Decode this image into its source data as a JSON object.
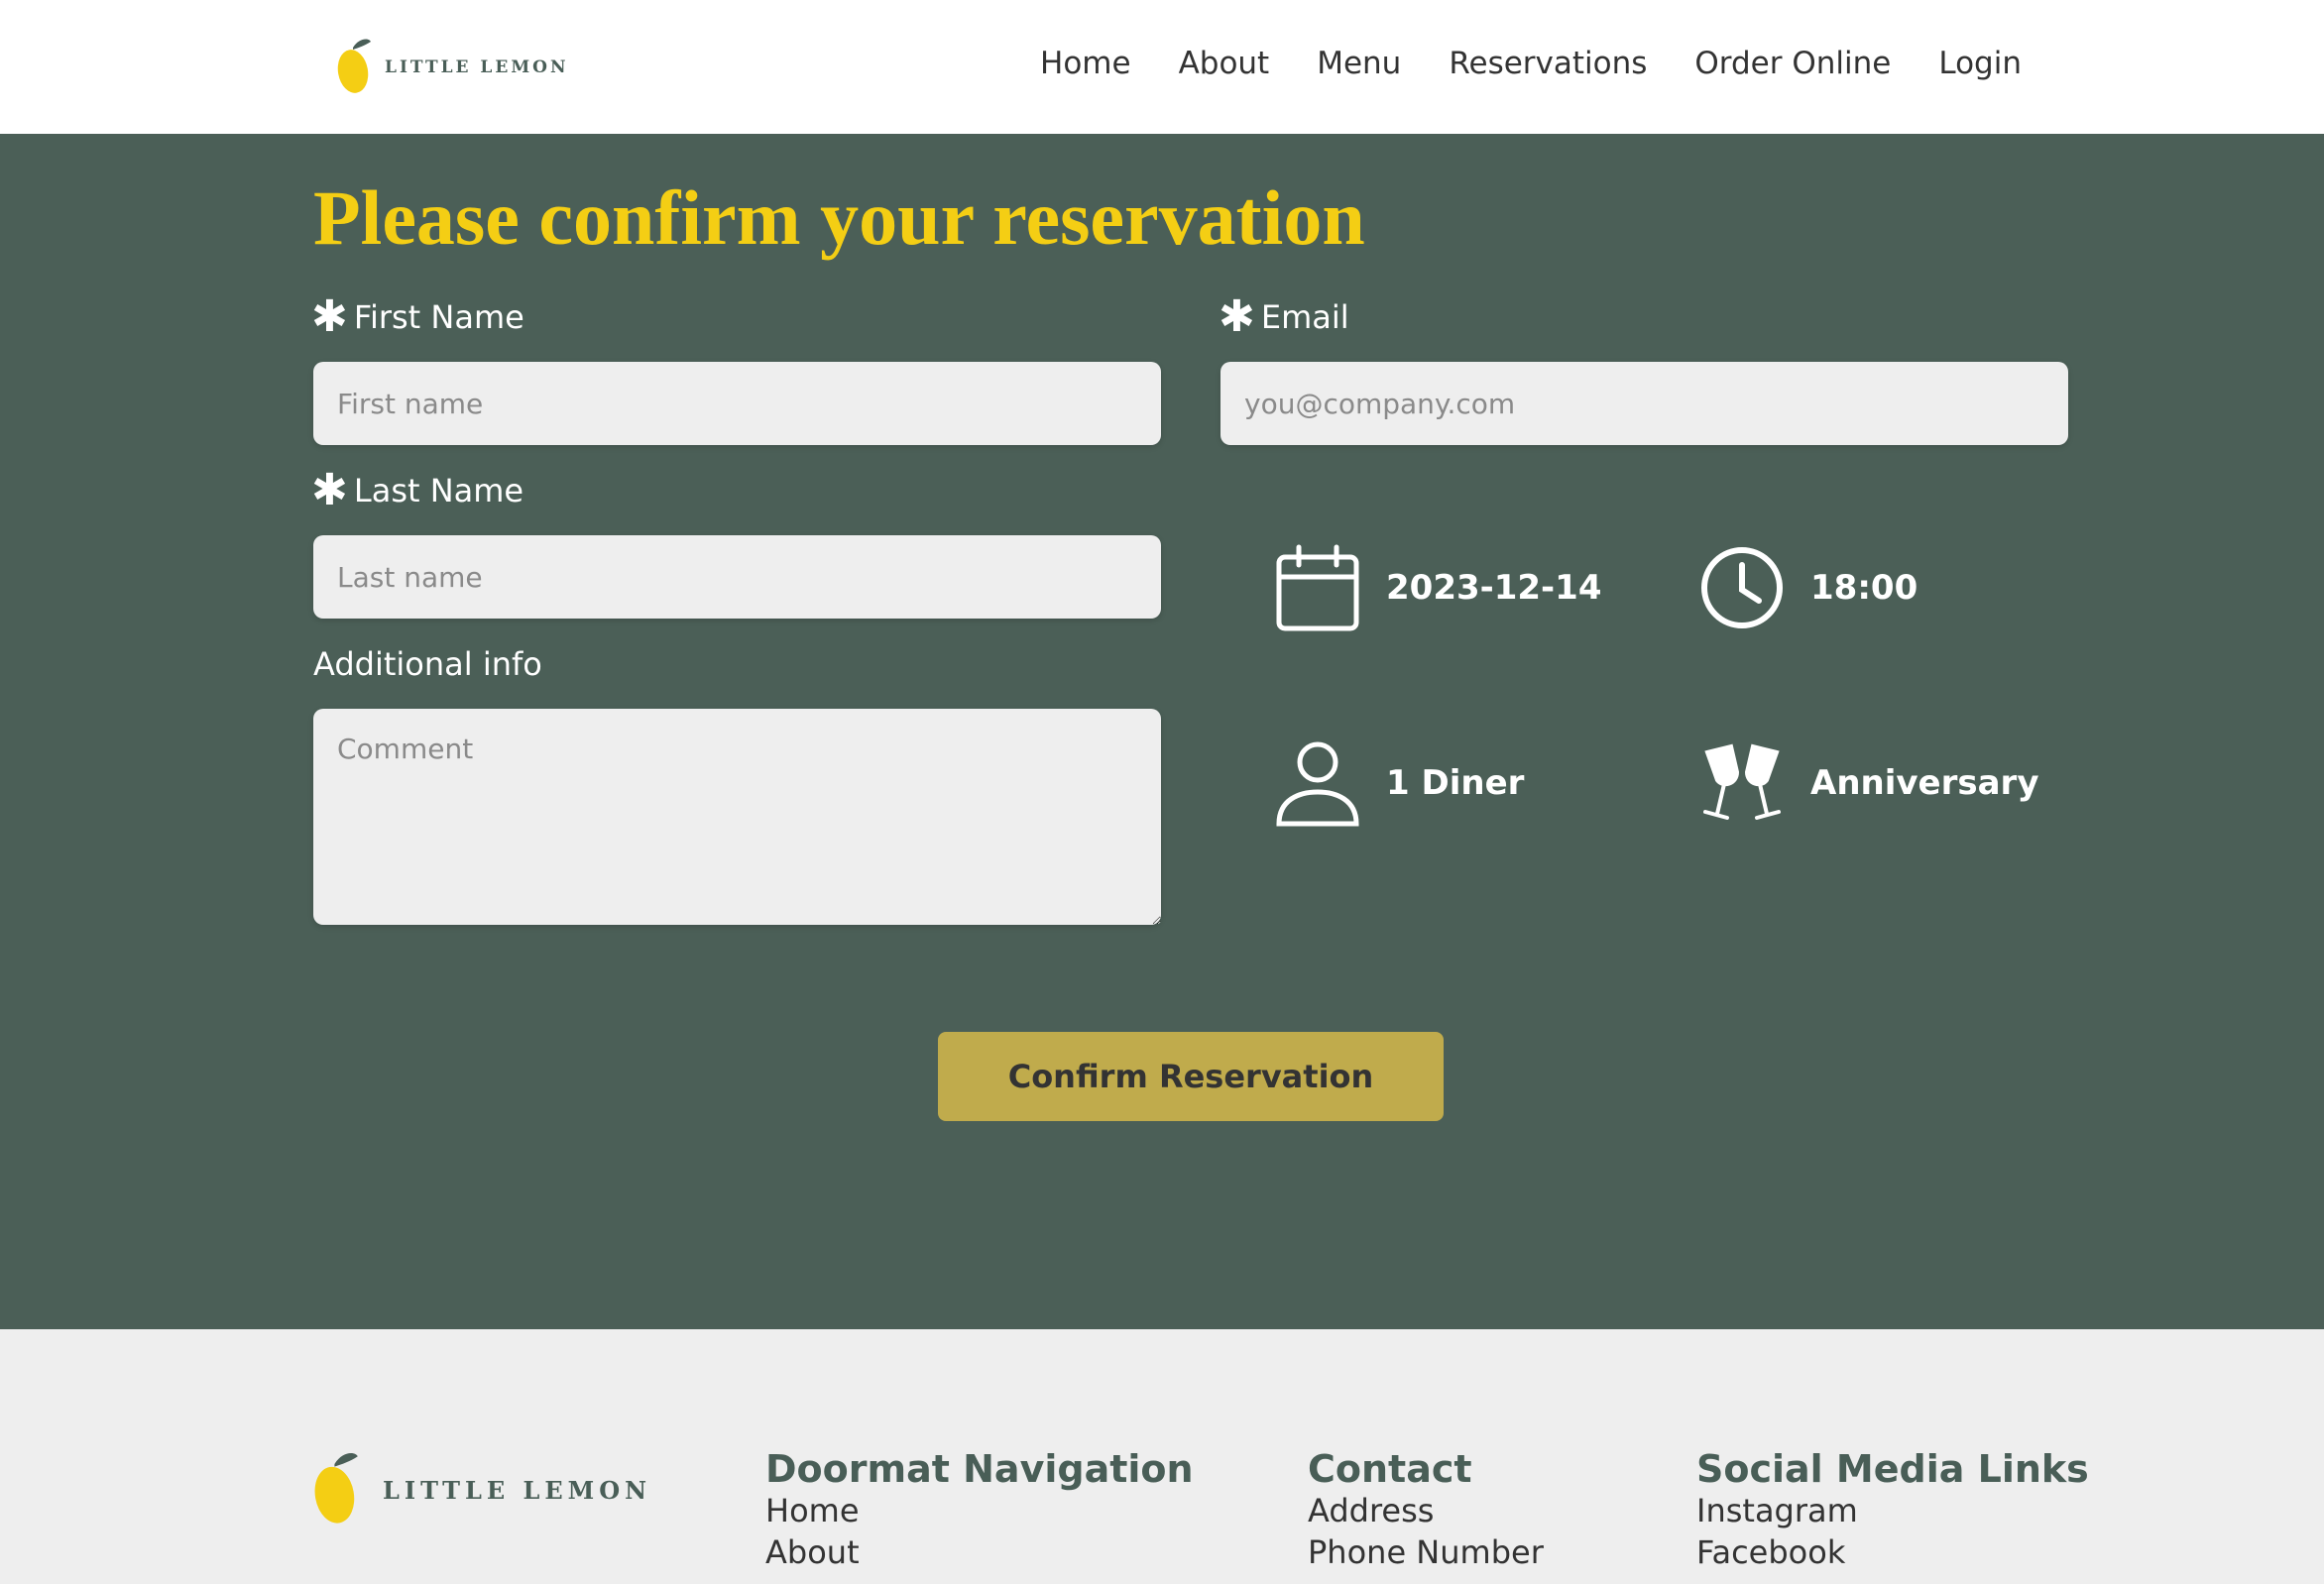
{
  "header": {
    "logo_text": "LITTLE LEMON",
    "nav": [
      "Home",
      "About",
      "Menu",
      "Reservations",
      "Order Online",
      "Login"
    ]
  },
  "main": {
    "title": "Please confirm your reservation",
    "required_marker": "✱",
    "first_name": {
      "label": "First Name",
      "placeholder": "First name"
    },
    "last_name": {
      "label": "Last Name",
      "placeholder": "Last name"
    },
    "additional": {
      "label": "Additional info",
      "placeholder": "Comment"
    },
    "email": {
      "label": "Email",
      "placeholder": "you@company.com"
    },
    "summary": {
      "date": "2023-12-14",
      "time": "18:00",
      "diners": "1 Diner",
      "occasion": "Anniversary"
    },
    "confirm_label": "Confirm Reservation"
  },
  "footer": {
    "logo_text": "LITTLE LEMON",
    "doormat": {
      "heading": "Doormat Navigation",
      "items": [
        "Home",
        "About"
      ]
    },
    "contact": {
      "heading": "Contact",
      "items": [
        "Address",
        "Phone Number"
      ]
    },
    "social": {
      "heading": "Social Media Links",
      "items": [
        "Instagram",
        "Facebook"
      ]
    }
  },
  "colors": {
    "primary_green": "#4b5f57",
    "primary_yellow": "#f4ce14",
    "button": "#c0ab4c",
    "input_bg": "#eeeeee"
  },
  "icons": [
    "lemon-logo-icon",
    "calendar-icon",
    "clock-icon",
    "person-icon",
    "cheers-icon"
  ]
}
